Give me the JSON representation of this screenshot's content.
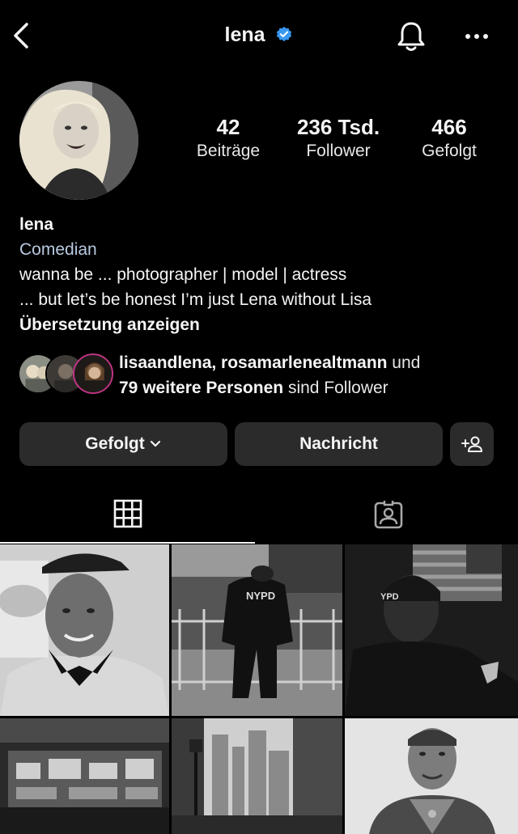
{
  "header": {
    "username": "lena",
    "back_icon": "chevron-left-icon",
    "verified_icon": "verified-badge-icon",
    "notification_icon": "bell-icon",
    "more_icon": "more-horizontal-icon",
    "verified_color": "#3897f0"
  },
  "stats": {
    "posts_count": "42",
    "posts_label": "Beiträge",
    "followers_count": "236 Tsd.",
    "followers_label": "Follower",
    "following_count": "466",
    "following_label": "Gefolgt"
  },
  "bio": {
    "name": "lena",
    "category": "Comedian",
    "line1": "wanna be ... photographer | model | actress",
    "line2": "... but let’s be honest I’m just Lena without Lisa",
    "translate": "Übersetzung anzeigen"
  },
  "mutual": {
    "names": "lisaandlena, rosamarlenealtmann",
    "and": " und",
    "others": "79 weitere Personen",
    "suffix": " sind Follower"
  },
  "actions": {
    "follow_label": "Gefolgt",
    "follow_icon": "chevron-down-icon",
    "message_label": "Nachricht",
    "add_user_icon": "add-user-icon"
  },
  "tabs": {
    "grid_icon": "grid-icon",
    "tagged_icon": "tagged-person-icon",
    "active": "grid"
  },
  "posts": [
    {
      "subject": "portrait man cap bandana"
    },
    {
      "subject": "NYPD officer at barricade"
    },
    {
      "subject": "NYPD officer with flag"
    },
    {
      "subject": "street food cart"
    },
    {
      "subject": "city street lamp"
    },
    {
      "subject": "tattooed man portrait"
    }
  ]
}
